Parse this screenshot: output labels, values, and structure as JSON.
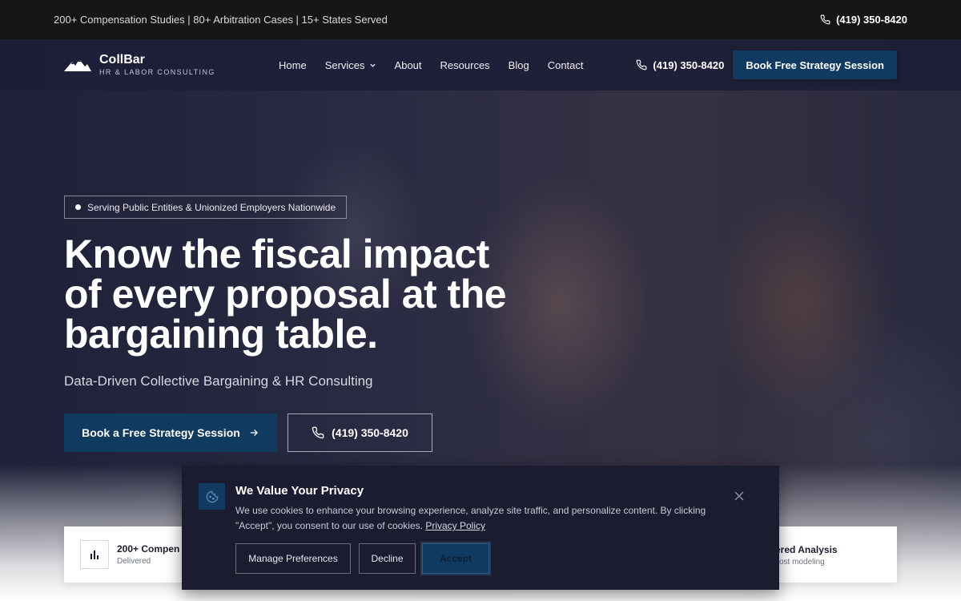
{
  "topbar": {
    "stats": "200+ Compensation Studies | 80+ Arbitration Cases | 15+ States Served",
    "phone": "(419) 350-8420"
  },
  "nav": {
    "brand": "CollBar",
    "tagline": "HR & LABOR CONSULTING",
    "menu": [
      "Home",
      "Services",
      "About",
      "Resources",
      "Blog",
      "Contact"
    ],
    "phone": "(419) 350-8420",
    "cta": "Book Free Strategy Session"
  },
  "hero": {
    "badge": "Serving Public Entities & Unionized Employers Nationwide",
    "headline_lines": [
      "Know the fiscal impact",
      "of every proposal at the",
      "bargaining table."
    ],
    "subhead": "Data-Driven Collective Bargaining & HR Consulting",
    "primary_button": "Book a Free Strategy Session",
    "phone_button": "(419) 350-8420"
  },
  "stats_strip": {
    "left_title": "200+ Compen",
    "left_sub": "Delivered",
    "right_title": "ered Analysis",
    "right_sub": "cost modeling"
  },
  "cookie": {
    "title": "We Value Your Privacy",
    "text": "We use cookies to enhance your browsing experience, analyze site traffic, and personalize content. By clicking \"Accept\", you consent to our use of cookies.",
    "link": "Privacy Policy",
    "manage": "Manage Preferences",
    "decline": "Decline",
    "accept": "Accept"
  },
  "colors": {
    "brand_navy": "#103a5f",
    "topbar": "#161616",
    "modal_bg": "#1c1c30"
  }
}
